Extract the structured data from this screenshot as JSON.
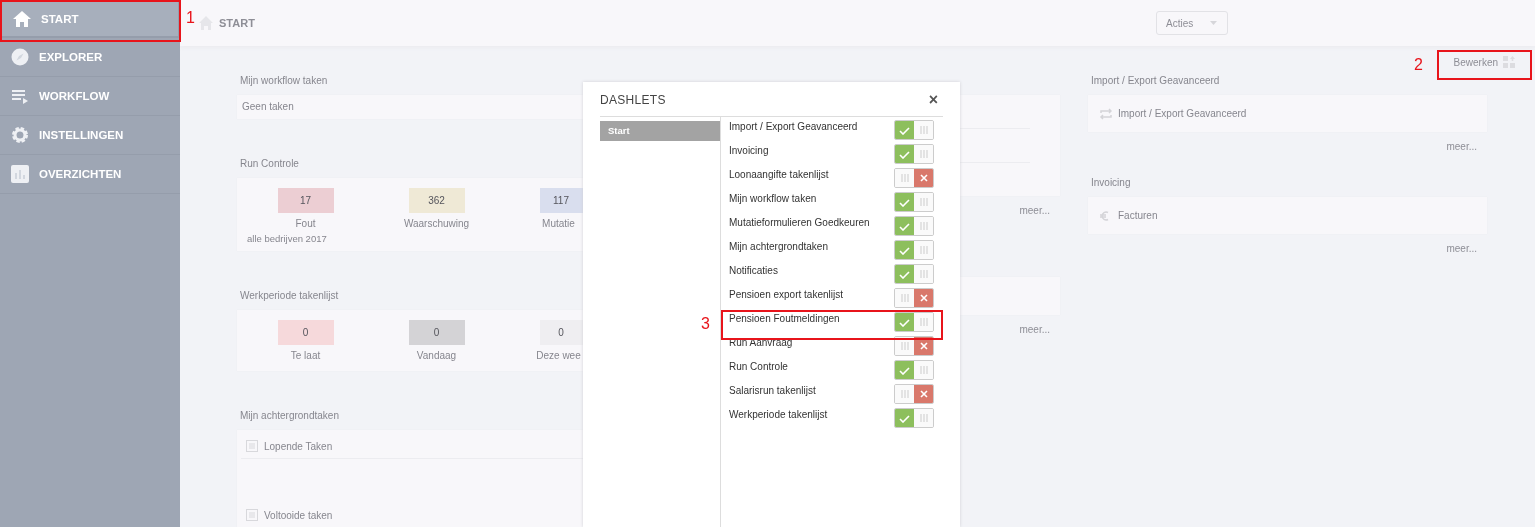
{
  "sidebar": {
    "items": [
      {
        "label": "START",
        "selected": true
      },
      {
        "label": "EXPLORER",
        "selected": false
      },
      {
        "label": "WORKFLOW",
        "selected": false
      },
      {
        "label": "INSTELLINGEN",
        "selected": false
      },
      {
        "label": "OVERZICHTEN",
        "selected": false
      }
    ]
  },
  "topbar": {
    "breadcrumb": "START",
    "actions_button": "Acties"
  },
  "edit_button": "Bewerken",
  "columns": [
    {
      "widgets": [
        {
          "kind": "list",
          "title": "Mijn workflow taken",
          "rows": [
            "Geen taken"
          ]
        },
        {
          "kind": "counters",
          "title": "Run Controle",
          "note": "alle bedrijven 2017",
          "counters": [
            {
              "value": "17",
              "label": "Fout",
              "color": "#ecced3"
            },
            {
              "value": "362",
              "label": "Waarschuwing",
              "color": "#efe9d6"
            },
            {
              "value": "117",
              "label": "Mutatie",
              "color": "#d9deee"
            }
          ]
        },
        {
          "kind": "counters",
          "title": "Werkperiode takenlijst",
          "counters": [
            {
              "value": "0",
              "label": "Te laat",
              "color": "#f6d9db"
            },
            {
              "value": "0",
              "label": "Vandaag",
              "color": "#d4d3d6"
            },
            {
              "value": "0",
              "label": "Deze wee",
              "color": "#efeef1"
            }
          ]
        },
        {
          "kind": "tasks",
          "title": "Mijn achtergrondtaken",
          "rows": [
            "Lopende Taken",
            "Voltooide taken"
          ]
        }
      ]
    },
    {
      "widgets": [
        {
          "kind": "blank",
          "more": "meer..."
        },
        {
          "kind": "blank_small",
          "more": "meer..."
        }
      ]
    },
    {
      "widgets": [
        {
          "kind": "link",
          "title": "Import / Export Geavanceerd",
          "link": "Import / Export Geavanceerd",
          "more": "meer..."
        },
        {
          "kind": "link",
          "title": "Invoicing",
          "link": "Facturen",
          "more": "meer..."
        }
      ]
    }
  ],
  "dashlets": {
    "title": "DASHLETS",
    "close": "×",
    "nav": [
      {
        "label": "Start",
        "selected": true
      }
    ],
    "items": [
      {
        "label": "Import / Export Geavanceerd",
        "on": true
      },
      {
        "label": "Invoicing",
        "on": true
      },
      {
        "label": "Loonaangifte takenlijst",
        "on": false
      },
      {
        "label": "Mijn workflow taken",
        "on": true
      },
      {
        "label": "Mutatieformulieren Goedkeuren",
        "on": true
      },
      {
        "label": "Mijn achtergrondtaken",
        "on": true
      },
      {
        "label": "Notificaties",
        "on": true
      },
      {
        "label": "Pensioen export takenlijst",
        "on": false
      },
      {
        "label": "Pensioen Foutmeldingen",
        "on": true
      },
      {
        "label": "Run Aanvraag",
        "on": false
      },
      {
        "label": "Run Controle",
        "on": true
      },
      {
        "label": "Salarisrun takenlijst",
        "on": false
      },
      {
        "label": "Werkperiode takenlijst",
        "on": true
      }
    ]
  },
  "annotations": [
    {
      "number": "1"
    },
    {
      "number": "2"
    },
    {
      "number": "3"
    }
  ]
}
